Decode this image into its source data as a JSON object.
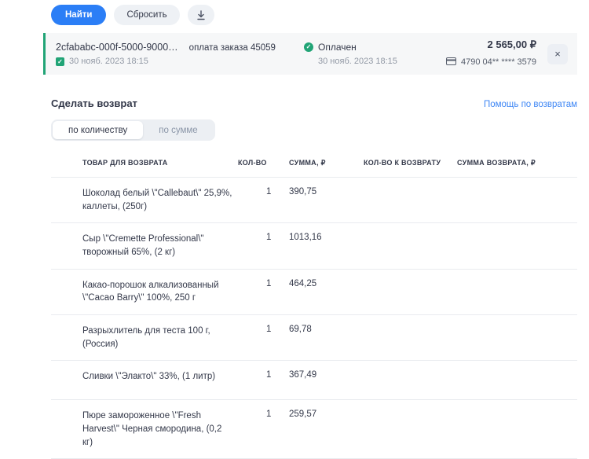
{
  "toolbar": {
    "find_label": "Найти",
    "reset_label": "Сбросить",
    "download_icon": "download-icon"
  },
  "payment": {
    "id": "2cfababc-000f-5000-9000…",
    "order_label": "оплата заказа 45059",
    "created_date": "30 нояб. 2023 18:15",
    "status_label": "Оплачен",
    "status_date": "30 нояб. 2023 18:15",
    "amount": "2 565,00 ₽",
    "card_number": "4790 04** **** 3579",
    "close_label": "×"
  },
  "refund": {
    "title": "Сделать возврат",
    "help_link": "Помощь по возвратам",
    "tabs": [
      {
        "label": "по количеству",
        "active": true
      },
      {
        "label": "по сумме",
        "active": false
      }
    ],
    "table": {
      "headers": {
        "product": "ТОВАР ДЛЯ ВОЗВРАТА",
        "qty": "КОЛ-ВО",
        "sum": "СУММА, ₽",
        "refund_qty": "КОЛ-ВО К ВОЗВРАТУ",
        "refund_sum": "СУММА ВОЗВРАТА, ₽"
      },
      "rows": [
        {
          "name": "Шоколад белый \\\"Callebaut\\\" 25,9%, каллеты, (250г)",
          "qty": "1",
          "sum": "390,75",
          "refund_qty": "",
          "refund_sum": ""
        },
        {
          "name": "Сыр \\\"Cremette Professional\\\" творожный 65%, (2 кг)",
          "qty": "1",
          "sum": "1013,16",
          "refund_qty": "",
          "refund_sum": ""
        },
        {
          "name": "Какао-порошок алкализованный \\\"Cacao Barry\\\" 100%, 250 г",
          "qty": "1",
          "sum": "464,25",
          "refund_qty": "",
          "refund_sum": ""
        },
        {
          "name": "Разрыхлитель для теста 100 г, (Россия)",
          "qty": "1",
          "sum": "69,78",
          "refund_qty": "",
          "refund_sum": ""
        },
        {
          "name": "Сливки \\\"Элакто\\\" 33%, (1 литр)",
          "qty": "1",
          "sum": "367,49",
          "refund_qty": "",
          "refund_sum": ""
        },
        {
          "name": "Пюре замороженное \\\"Fresh Harvest\\\" Черная смородина, (0,2 кг)",
          "qty": "1",
          "sum": "259,57",
          "refund_qty": "",
          "refund_sum": ""
        }
      ]
    }
  },
  "colors": {
    "primary_blue": "#2b7ef6",
    "link_blue": "#3f87f5",
    "success_green": "#21a476",
    "header_bg": "#f6f7f8",
    "text_dark": "#333849",
    "text_muted": "#9299a5",
    "divider": "#e9ebef"
  }
}
